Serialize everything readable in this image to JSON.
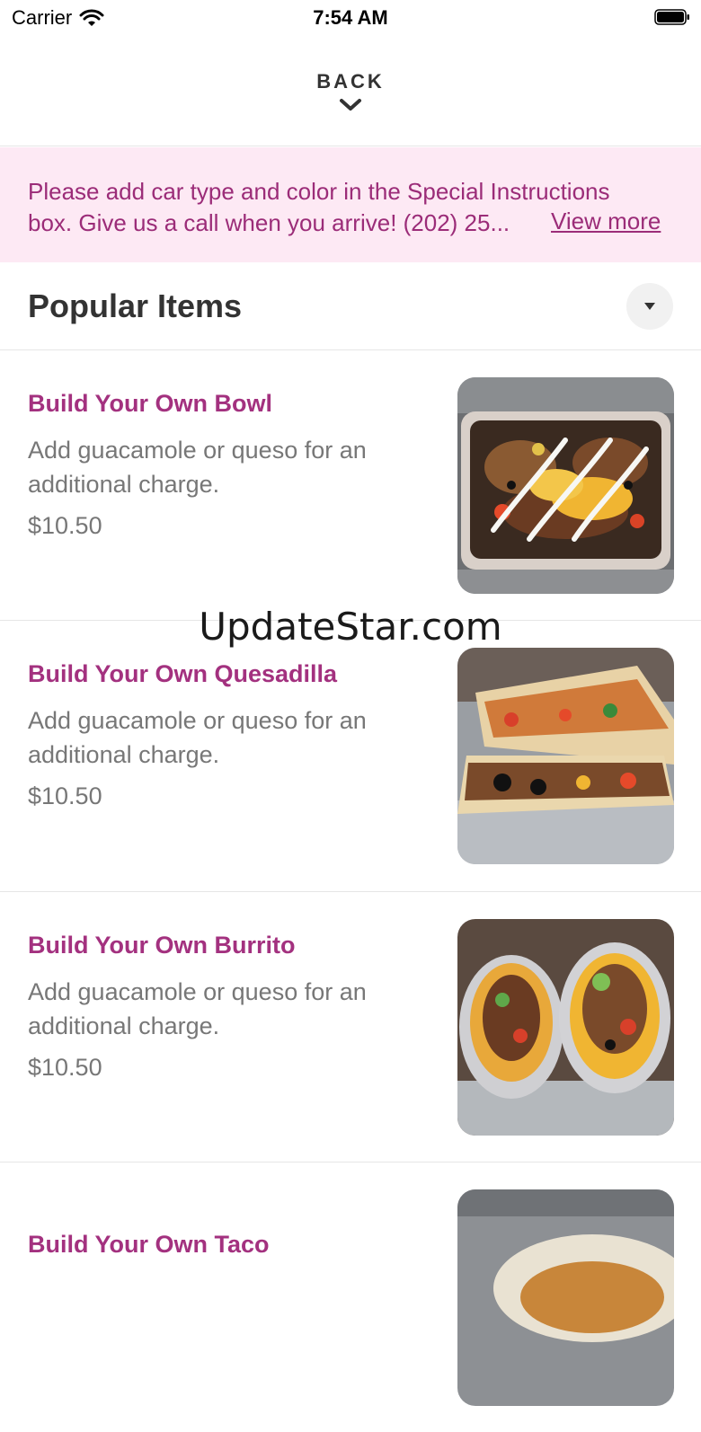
{
  "status_bar": {
    "carrier": "Carrier",
    "time": "7:54 AM"
  },
  "nav": {
    "back_label": "BACK"
  },
  "notice": {
    "line1": "Please add car type and color in the Special Instructions",
    "line2": "box. Give us a call when you arrive! (202) 25...",
    "link": "View more"
  },
  "section": {
    "title": "Popular Items"
  },
  "items": [
    {
      "name": "Build Your Own Bowl",
      "description": "Add guacamole or queso for an additional charge.",
      "price": "$10.50"
    },
    {
      "name": "Build Your Own Quesadilla",
      "description": "Add guacamole or queso for an additional charge.",
      "price": "$10.50"
    },
    {
      "name": "Build Your Own Burrito",
      "description": "Add guacamole or queso for an additional charge.",
      "price": "$10.50"
    },
    {
      "name": "Build Your Own Taco"
    }
  ],
  "watermark": "UpdateStar.com",
  "colors": {
    "accent": "#a3317f",
    "notice_bg": "#fde9f4",
    "notice_text": "#9b2c78"
  }
}
